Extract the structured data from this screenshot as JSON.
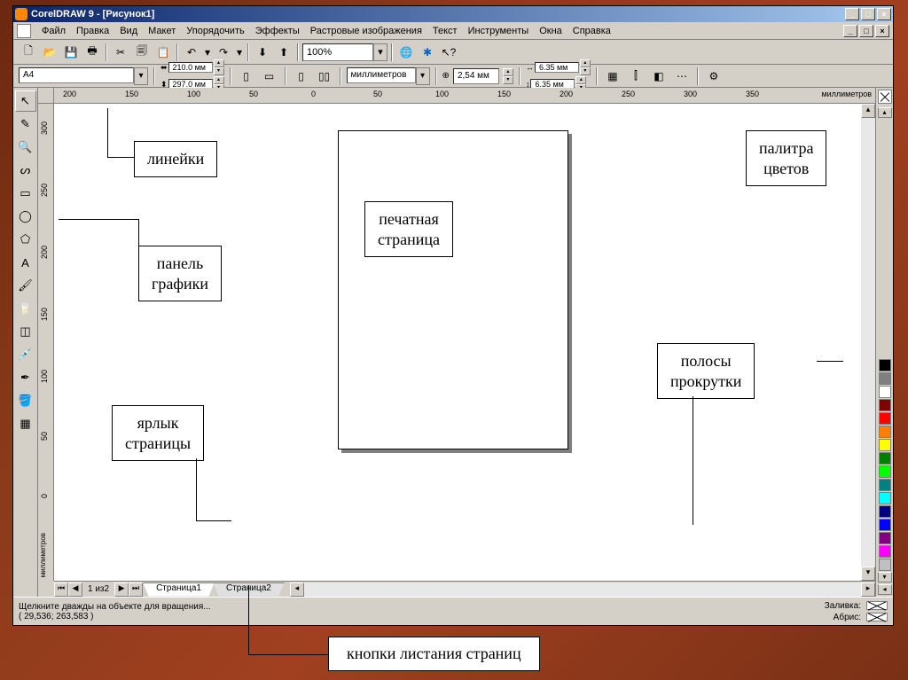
{
  "titlebar": {
    "text": "CorelDRAW 9 - [Рисунок1]"
  },
  "menu": {
    "items": [
      {
        "label": "Файл",
        "u": "Ф"
      },
      {
        "label": "Правка",
        "u": "П"
      },
      {
        "label": "Вид",
        "u": "В"
      },
      {
        "label": "Макет",
        "u": "М"
      },
      {
        "label": "Упорядочить",
        "u": "У"
      },
      {
        "label": "Эффекты",
        "u": "Э"
      },
      {
        "label": "Растровые изображения",
        "u": "Р"
      },
      {
        "label": "Текст",
        "u": "Т"
      },
      {
        "label": "Инструменты",
        "u": "И"
      },
      {
        "label": "Окна",
        "u": "О"
      },
      {
        "label": "Справка",
        "u": "С"
      }
    ]
  },
  "toolbar": {
    "zoom_value": "100%"
  },
  "propbar": {
    "paper": "A4",
    "width": "210.0 мм",
    "height": "297.0 мм",
    "units": "миллиметров",
    "nudge": "2,54 мм",
    "dup_x": "6.35 мм",
    "dup_y": "6.35 мм"
  },
  "ruler": {
    "h_ticks": [
      "200",
      "150",
      "100",
      "50",
      "0",
      "50",
      "100",
      "150",
      "200",
      "250",
      "300",
      "350"
    ],
    "h_unit": "миллиметров",
    "v_ticks": [
      "300",
      "250",
      "200",
      "150",
      "100",
      "50",
      "0"
    ],
    "v_unit": "миллиметров"
  },
  "annotations": {
    "rulers": "линейки",
    "graphics_panel_l1": "панель",
    "graphics_panel_l2": "графики",
    "page_tab_l1": "ярлык",
    "page_tab_l2": "страницы",
    "print_page_l1": "печатная",
    "print_page_l2": "страница",
    "palette_l1": "палитра",
    "palette_l2": "цветов",
    "scroll_l1": "полосы",
    "scroll_l2": "прокрутки",
    "page_buttons": "кнопки листания страниц"
  },
  "page_nav": {
    "count": "1 из2",
    "tabs": [
      "Страница1",
      "Страница2"
    ]
  },
  "status": {
    "hint": "Щелкните дважды на объекте для вращения...",
    "coords": "( 29,536; 263,583 )",
    "fill_label": "Заливка:",
    "outline_label": "Абрис:"
  },
  "palette_colors": [
    "#000000",
    "#7f7f7f",
    "#ffffff",
    "#800000",
    "#ff0000",
    "#ff8000",
    "#ffff00",
    "#008000",
    "#00ff00",
    "#008080",
    "#00ffff",
    "#000080",
    "#0000ff",
    "#800080",
    "#ff00ff",
    "#c0c0c0"
  ]
}
